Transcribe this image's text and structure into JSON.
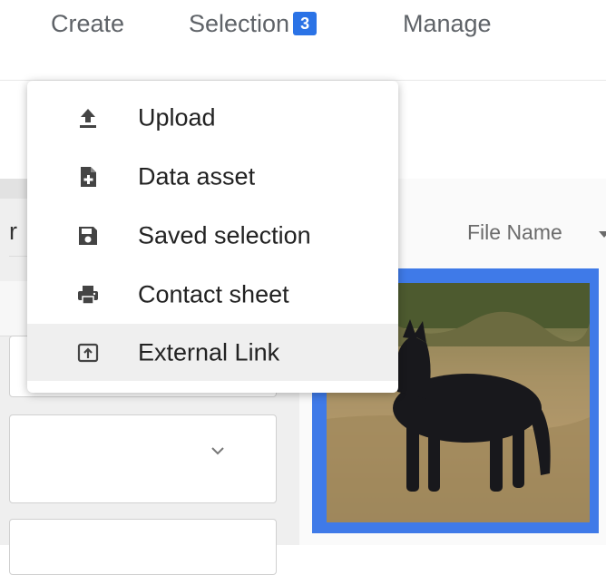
{
  "nav": {
    "create": "Create",
    "selection": "Selection",
    "selection_count": "3",
    "manage": "Manage"
  },
  "panel": {
    "partial_label": "r"
  },
  "grid": {
    "sort_label": "File Name"
  },
  "menu": {
    "items": [
      {
        "label": "Upload",
        "icon": "upload-icon"
      },
      {
        "label": "Data asset",
        "icon": "file-plus-icon"
      },
      {
        "label": "Saved selection",
        "icon": "save-icon"
      },
      {
        "label": "Contact sheet",
        "icon": "print-icon"
      },
      {
        "label": "External Link",
        "icon": "external-link-icon"
      }
    ],
    "hovered_index": 4
  },
  "colors": {
    "accent": "#2b73e6",
    "selection_border": "#3f7ae8",
    "menu_hover": "#efefef"
  }
}
